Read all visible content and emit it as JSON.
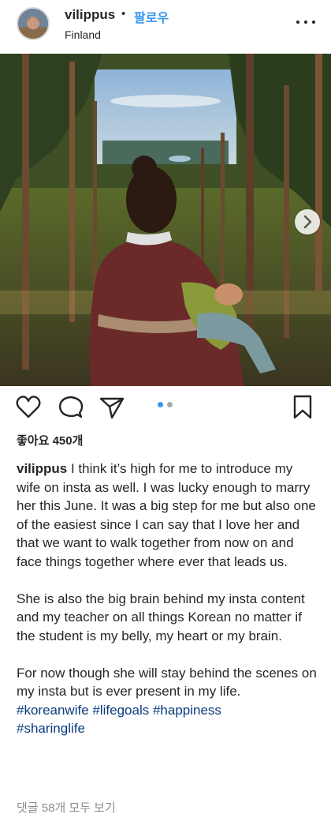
{
  "header": {
    "username": "vilippus",
    "separator": "•",
    "follow_label": "팔로우",
    "location": "Finland"
  },
  "post": {
    "likes_label": "좋아요 450개",
    "carousel": {
      "current_slide": 1,
      "total_slides": 2
    },
    "caption": {
      "username": "vilippus",
      "paragraph_1": "I think it’s high for me to introduce my wife on insta as well. I was lucky enough to marry her this June. It was a big step for me but also one of the easiest since I can say that I love her and that we want to walk together from now on and face things together where ever that leads us.",
      "paragraph_2": "She is also the big brain behind my insta content and my teacher on all things Korean no matter if the student is my belly, my heart or my brain.",
      "paragraph_3": "For now though she will stay behind the scenes on my insta but is ever present in my life.",
      "hashtags": [
        "#koreanwife",
        "#lifegoals",
        "#happiness",
        "#sharinglife"
      ]
    },
    "comments_link": "댓글 58개 모두 보기"
  },
  "colors": {
    "link_blue": "#3897f0",
    "hashtag": "#003569",
    "muted": "#8e8e8e",
    "text": "#262626"
  }
}
